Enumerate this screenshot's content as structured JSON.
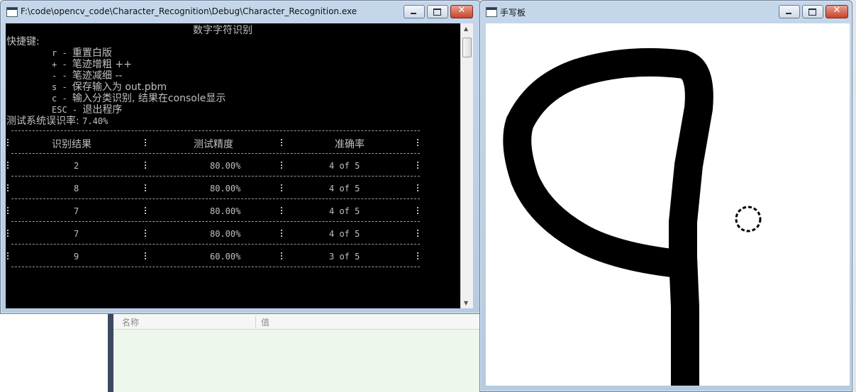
{
  "background": {
    "panel_headers": [
      "名称",
      "值"
    ]
  },
  "console_window": {
    "title": "F:\\code\\opencv_code\\Character_Recognition\\Debug\\Character_Recognition.exe",
    "heading": "数字字符识别",
    "shortcuts_label": "快捷键:",
    "shortcuts": [
      {
        "key": "r",
        "sep": " - ",
        "desc": "重置白版"
      },
      {
        "key": "+",
        "sep": " - ",
        "desc": "笔迹增粗 ++"
      },
      {
        "key": "-",
        "sep": " - ",
        "desc": "笔迹减细 --"
      },
      {
        "key": "s",
        "sep": " - ",
        "desc": "保存输入为 out.pbm"
      },
      {
        "key": "c",
        "sep": " - ",
        "desc": "输入分类识别, 结果在console显示"
      },
      {
        "key": "ESC",
        "sep": " - ",
        "desc": "退出程序"
      }
    ],
    "error_rate_label": "测试系统误识率: ",
    "error_rate_value": "7.40%",
    "table": {
      "headers": [
        "识别结果",
        "测试精度",
        "准确率"
      ],
      "rows": [
        {
          "result": "2",
          "precision": "80.00%",
          "accuracy": "4 of 5"
        },
        {
          "result": "8",
          "precision": "80.00%",
          "accuracy": "4 of 5"
        },
        {
          "result": "7",
          "precision": "80.00%",
          "accuracy": "4 of 5"
        },
        {
          "result": "7",
          "precision": "80.00%",
          "accuracy": "4 of 5"
        },
        {
          "result": "9",
          "precision": "60.00%",
          "accuracy": "3 of 5"
        }
      ]
    }
  },
  "board_window": {
    "title": "手写板",
    "drawn_digit": "9"
  },
  "colors": {
    "console_bg": "#000000",
    "console_text": "#c0c0c0",
    "canvas_bg": "#ffffff",
    "ink": "#000000"
  }
}
